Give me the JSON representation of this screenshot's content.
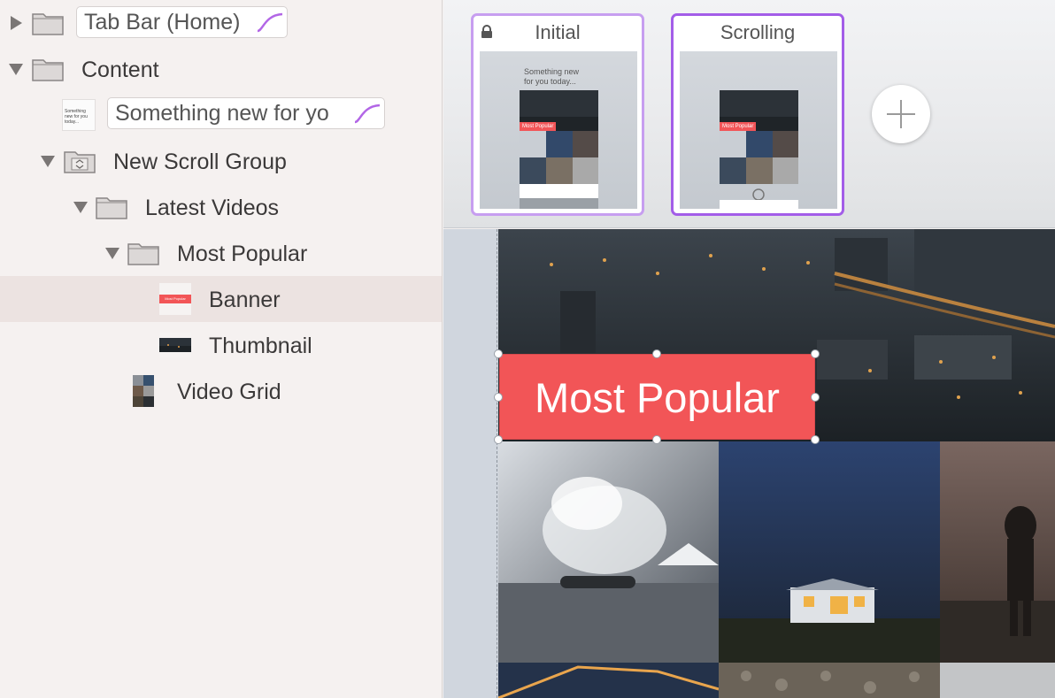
{
  "layers": {
    "items": [
      {
        "label": "Tab Bar (Home)",
        "type": "folder",
        "style": "pill",
        "state": "collapsed"
      },
      {
        "label": "Content",
        "type": "folder",
        "state": "expanded"
      },
      {
        "label": "Something new for yo",
        "type": "text-layer",
        "style": "pill",
        "thumb_text": "Something new for you today..."
      },
      {
        "label": "New Scroll Group",
        "type": "scroll-group",
        "state": "expanded"
      },
      {
        "label": "Latest Videos",
        "type": "folder",
        "state": "expanded"
      },
      {
        "label": "Most Popular",
        "type": "folder",
        "state": "expanded"
      },
      {
        "label": "Banner",
        "type": "image-layer",
        "selected": true,
        "thumb_text": "Most Popular"
      },
      {
        "label": "Thumbnail",
        "type": "image-layer"
      },
      {
        "label": "Video Grid",
        "type": "image-layer"
      }
    ]
  },
  "states": {
    "items": [
      {
        "title": "Initial",
        "locked": true,
        "preview_text": "Something new for you today...",
        "banner_text": "Most Popular"
      },
      {
        "title": "Scrolling",
        "locked": false,
        "active": true,
        "banner_text": "Most Popular"
      }
    ],
    "add_icon": "plus-icon"
  },
  "canvas": {
    "banner_text": "Most Popular"
  },
  "colors": {
    "accent": "#a35de8",
    "accent_light": "#c79ef0",
    "banner": "#f25557",
    "selection": "#ece3e1"
  }
}
